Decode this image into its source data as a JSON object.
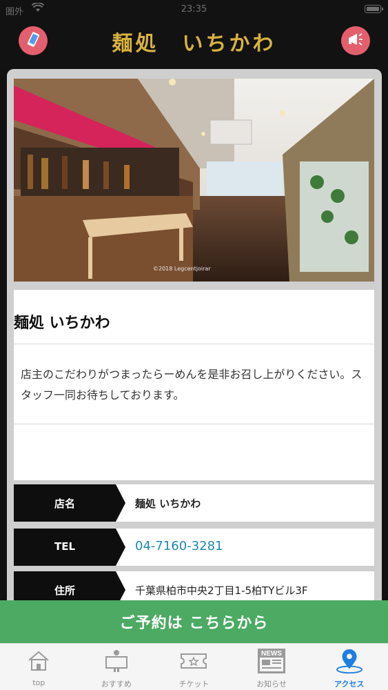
{
  "status_bar": {
    "carrier": "圏外",
    "time": "23:35"
  },
  "header": {
    "title": "麺処　いちかわ"
  },
  "photo": {
    "caption": "©2018 Legcentjoirar"
  },
  "shop": {
    "name": "麺処 いちかわ",
    "description": "店主のこだわりがつまったらーめんを是非お召し上がりください。スタッフ一同お待ちしております。"
  },
  "details": [
    {
      "label": "店名",
      "value": "麺処 いちかわ"
    },
    {
      "label": "TEL",
      "value": "04-7160-3281"
    },
    {
      "label": "住所",
      "value": "千葉県柏市中央2丁目1-5柏TYビル3F"
    }
  ],
  "reserve_button": {
    "label": "ご予約は こちらから"
  },
  "tabs": [
    {
      "label": "top",
      "icon": "home-icon"
    },
    {
      "label": "おすすめ",
      "icon": "recommend-icon"
    },
    {
      "label": "チケット",
      "icon": "ticket-icon"
    },
    {
      "label": "お知らせ",
      "icon": "news-icon",
      "icon_text": "NEWS"
    },
    {
      "label": "アクセス",
      "icon": "map-pin-icon",
      "active": true
    }
  ],
  "colors": {
    "accent_gold": "#d9b23f",
    "button_red": "#e45f6d",
    "reserve_green": "#4caa63",
    "tab_active_blue": "#1f7fe0",
    "tel_blue": "#1e88b0"
  }
}
